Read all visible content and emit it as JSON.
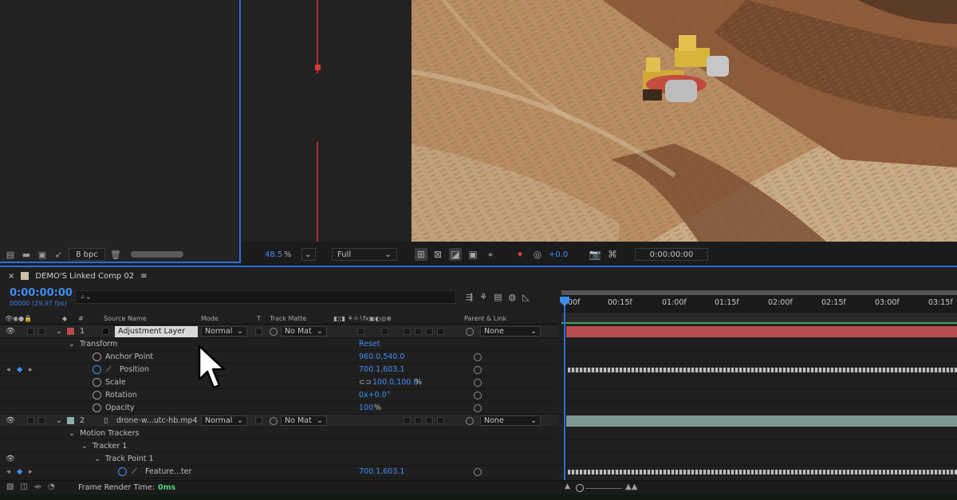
{
  "project": {
    "bpc": "8 bpc"
  },
  "viewer": {
    "zoom": "48.5",
    "zoom_unit": "%",
    "resolution": "Full",
    "exposure": "+0.0",
    "timecode": "0:00:00:00"
  },
  "timeline": {
    "tab_title": "DEMO'S Linked Comp 02",
    "timecode": "0:00:00:00",
    "fps_line": "00000 (29.97 fps)",
    "search_placeholder": "",
    "headers": {
      "num": "#",
      "source": "Source Name",
      "mode": "Mode",
      "t": "T",
      "matte": "Track Matte",
      "parent": "Parent & Link"
    },
    "ruler_ticks": [
      "00f",
      "00:15f",
      "01:00f",
      "01:15f",
      "02:00f",
      "02:15f",
      "03:00f",
      "03:15f"
    ],
    "layers": [
      {
        "num": "1",
        "name": "Adjustment Layer",
        "mode": "Normal",
        "matte": "No Mat",
        "parent": "None",
        "color": "#b84d4d"
      },
      {
        "num": "2",
        "name": "drone-w...utc-hb.mp4",
        "mode": "Normal",
        "matte": "No Mat",
        "parent": "None",
        "color": "#8fb0ab"
      }
    ],
    "transform": {
      "group": "Transform",
      "reset": "Reset",
      "anchor": {
        "label": "Anchor Point",
        "value": "960.0,540.0"
      },
      "position": {
        "label": "Position",
        "value": "700.1,603.1"
      },
      "scale": {
        "label": "Scale",
        "value": "100.0,100.0",
        "unit": "%"
      },
      "rotation": {
        "label": "Rotation",
        "value": "0x+0.0°"
      },
      "opacity": {
        "label": "Opacity",
        "value": "100",
        "unit": "%"
      }
    },
    "trackers": {
      "group": "Motion Trackers",
      "tracker": "Tracker 1",
      "track_point": "Track Point 1",
      "feature": {
        "label": "Feature...ter",
        "value": "700.1,603.1"
      }
    },
    "footer": {
      "render_label": "Frame Render Time:",
      "render_value": "0ms"
    }
  }
}
